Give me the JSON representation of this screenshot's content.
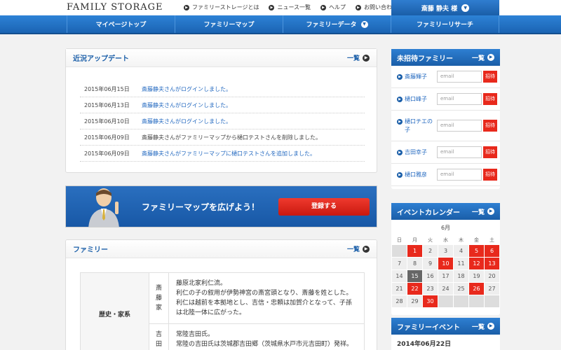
{
  "header": {
    "logo": "FAMILY STORAGE",
    "links": [
      "ファミリーストレージとは",
      "ニュース一覧",
      "ヘルプ",
      "お問い合わせ"
    ],
    "user": "斎藤 静夫 様"
  },
  "nav": {
    "items": [
      "マイページトップ",
      "ファミリーマップ",
      "ファミリーデータ",
      "ファミリーリサーチ"
    ]
  },
  "updates": {
    "title": "近況アップデート",
    "more": "一覧",
    "rows": [
      {
        "date": "2015年06月15日",
        "text": "斎藤静夫さんがログインしました。"
      },
      {
        "date": "2015年06月13日",
        "text": "斎藤静夫さんがログインしました。"
      },
      {
        "date": "2015年06月10日",
        "text": "斎藤静夫さんがログインしました。"
      },
      {
        "date": "2015年06月09日",
        "text": "斎藤静夫さんがファミリーマップから樋口テストさんを削除しました。"
      },
      {
        "date": "2015年06月09日",
        "text": "斎藤静夫さんがファミリーマップに樋口テストさんを追加しました。"
      }
    ]
  },
  "banner": {
    "text": "ファミリーマップを広げよう！",
    "button": "登録する"
  },
  "family": {
    "title": "ファミリー",
    "more": "一覧",
    "category": "歴史・家系",
    "clans": [
      {
        "name": "斎藤家",
        "lines": [
          "藤原北家利仁流。",
          "利仁の子の叙用が伊勢神宮の斎宮頭となり、斎藤を姓とした。",
          "利仁は越前を本拠地とし、吉信・忠頼は加賀介となって、子孫",
          "は北陸一体に広がった。"
        ]
      },
      {
        "name": "吉田",
        "lines": [
          "常陸吉田氏。",
          "常陸の吉田氏は茨城郡吉田郷（茨城県水戸市元吉田町）発祥。"
        ]
      }
    ]
  },
  "uninvited": {
    "title": "未招待ファミリー",
    "more": "一覧",
    "placeholder": "email",
    "button": "招待",
    "members": [
      "斎藤輝子",
      "樋口峰子",
      "樋口チエの子",
      "吉田幸子",
      "樋口雅彦"
    ]
  },
  "calendar": {
    "title": "イベントカレンダー",
    "more": "一覧",
    "month": "6月",
    "weekdays": [
      "日",
      "月",
      "火",
      "水",
      "木",
      "金",
      "土"
    ],
    "weeks": [
      [
        "",
        "1",
        "2",
        "3",
        "4",
        "5",
        "6"
      ],
      [
        "7",
        "8",
        "9",
        "10",
        "11",
        "12",
        "13"
      ],
      [
        "14",
        "15",
        "16",
        "17",
        "18",
        "19",
        "20"
      ],
      [
        "21",
        "22",
        "23",
        "24",
        "25",
        "26",
        "27"
      ],
      [
        "28",
        "29",
        "30",
        "",
        "",
        "",
        ""
      ]
    ],
    "event_days": [
      "1",
      "5",
      "6",
      "10",
      "12",
      "13",
      "22",
      "26",
      "30"
    ],
    "today": "15"
  },
  "events": {
    "title": "ファミリーイベント",
    "more": "一覧",
    "date": "2014年06月22日"
  }
}
